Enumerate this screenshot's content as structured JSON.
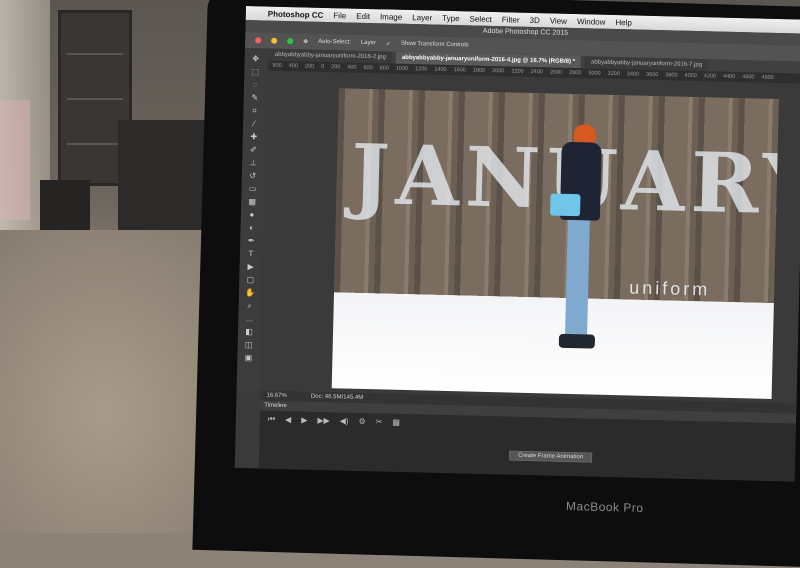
{
  "menubar": {
    "app_name": "Photoshop CC",
    "items": [
      "File",
      "Edit",
      "Image",
      "Layer",
      "Type",
      "Select",
      "Filter",
      "3D",
      "View",
      "Window",
      "Help"
    ]
  },
  "window": {
    "title": "Adobe Photoshop CC 2015"
  },
  "options_bar": {
    "auto_select_label": "Auto-Select:",
    "auto_select_value": "Layer",
    "transform_controls_label": "Show Transform Controls"
  },
  "tabs": [
    {
      "label": "abbyabbyabby-januaryuniform-2016-2.jpg",
      "active": false
    },
    {
      "label": "abbyabbyabby-januaryuniform-2016-4.jpg @ 16.7% (RGB/8) *",
      "active": true
    },
    {
      "label": "abbyabbyabby-januaryuniform-2016-7.jpg",
      "active": false
    }
  ],
  "ruler_ticks": [
    "800",
    "400",
    "200",
    "0",
    "200",
    "400",
    "600",
    "800",
    "1000",
    "1200",
    "1400",
    "1600",
    "1800",
    "2000",
    "2200",
    "2400",
    "2600",
    "2800",
    "3000",
    "3200",
    "3400",
    "3600",
    "3800",
    "4000",
    "4200",
    "4400",
    "4600",
    "4800"
  ],
  "canvas": {
    "headline": "JANUARY",
    "subline": "uniform"
  },
  "status": {
    "zoom": "16.67%",
    "doc": "Doc: 46.5M/145.4M"
  },
  "timeline": {
    "title": "Timeline",
    "create_button": "Create Frame Animation"
  },
  "laptop": {
    "brand": "MacBook Pro"
  }
}
